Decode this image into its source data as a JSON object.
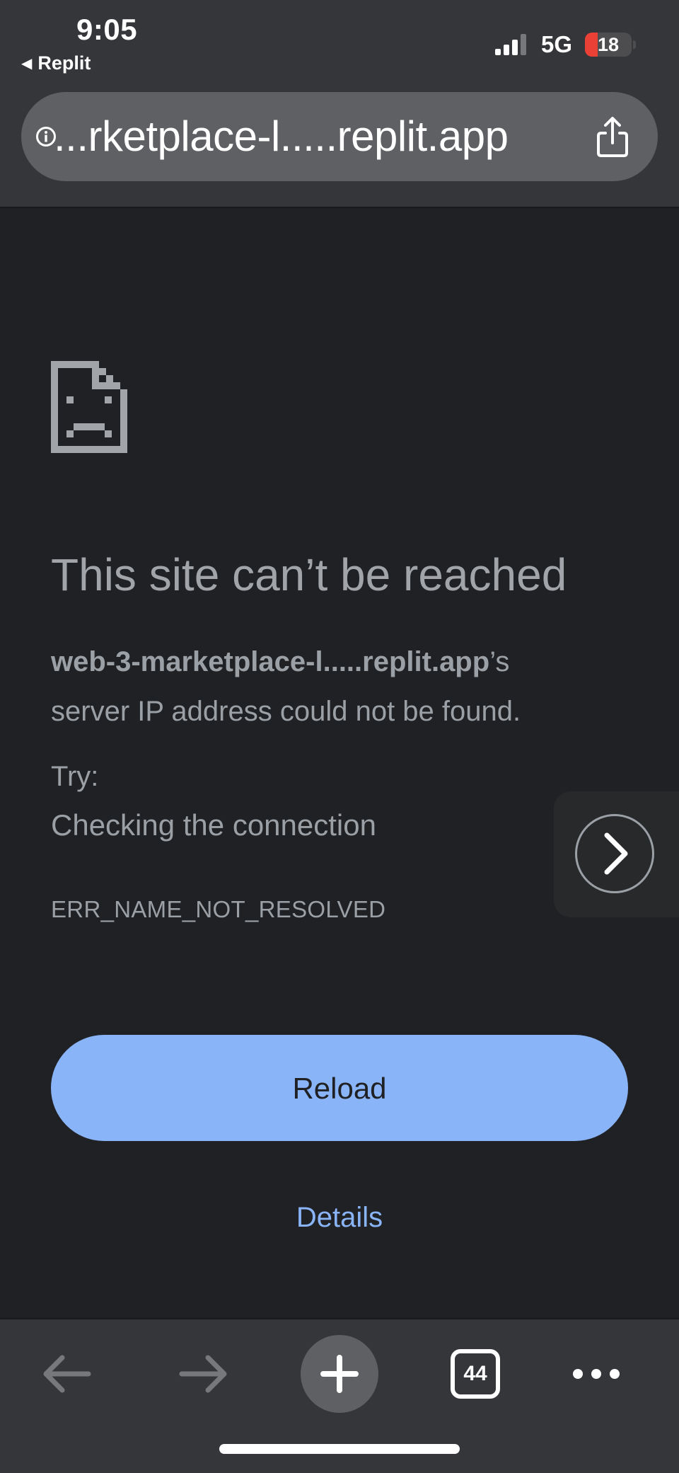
{
  "status_bar": {
    "time": "9:05",
    "back_app": "Replit",
    "network": "5G",
    "battery": "18"
  },
  "address_bar": {
    "url": "...rketplace-l.....replit.app"
  },
  "error": {
    "title": "This site can’t be reached",
    "host": "web-3-marketplace-l.....replit.app",
    "host_suffix": "’s",
    "description": "server IP address could not be found.",
    "try_label": "Try:",
    "suggestion": "Checking the connection",
    "code": "ERR_NAME_NOT_RESOLVED"
  },
  "actions": {
    "reload_label": "Reload",
    "details_label": "Details"
  },
  "toolbar": {
    "tab_count": "44"
  },
  "colors": {
    "accent": "#8ab4f8",
    "background": "#202124",
    "chrome": "#35363a"
  }
}
